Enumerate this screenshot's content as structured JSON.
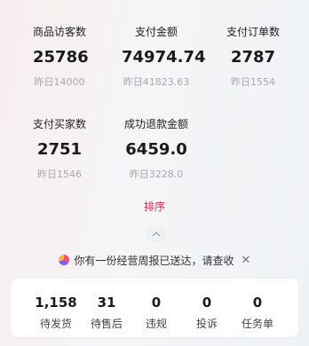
{
  "metrics": [
    {
      "label": "商品访客数",
      "value": "25786",
      "prev": "昨日14000"
    },
    {
      "label": "支付金额",
      "value": "74974.74",
      "prev": "昨日41823.63"
    },
    {
      "label": "支付订单数",
      "value": "2787",
      "prev": "昨日1554"
    },
    {
      "label": "支付买家数",
      "value": "2751",
      "prev": "昨日1546"
    },
    {
      "label": "成功退款金额",
      "value": "6459.0",
      "prev": "昨日3228.0"
    }
  ],
  "sort_label": "排序",
  "notice": {
    "text": "你有一份经营周报已送达，请查收",
    "close_symbol": "✕"
  },
  "todo": [
    {
      "value": "1,158",
      "label": "待发货"
    },
    {
      "value": "31",
      "label": "待售后"
    },
    {
      "value": "0",
      "label": "违规"
    },
    {
      "value": "0",
      "label": "投诉"
    },
    {
      "value": "0",
      "label": "任务单"
    }
  ],
  "colors": {
    "accent": "#e8274c"
  }
}
